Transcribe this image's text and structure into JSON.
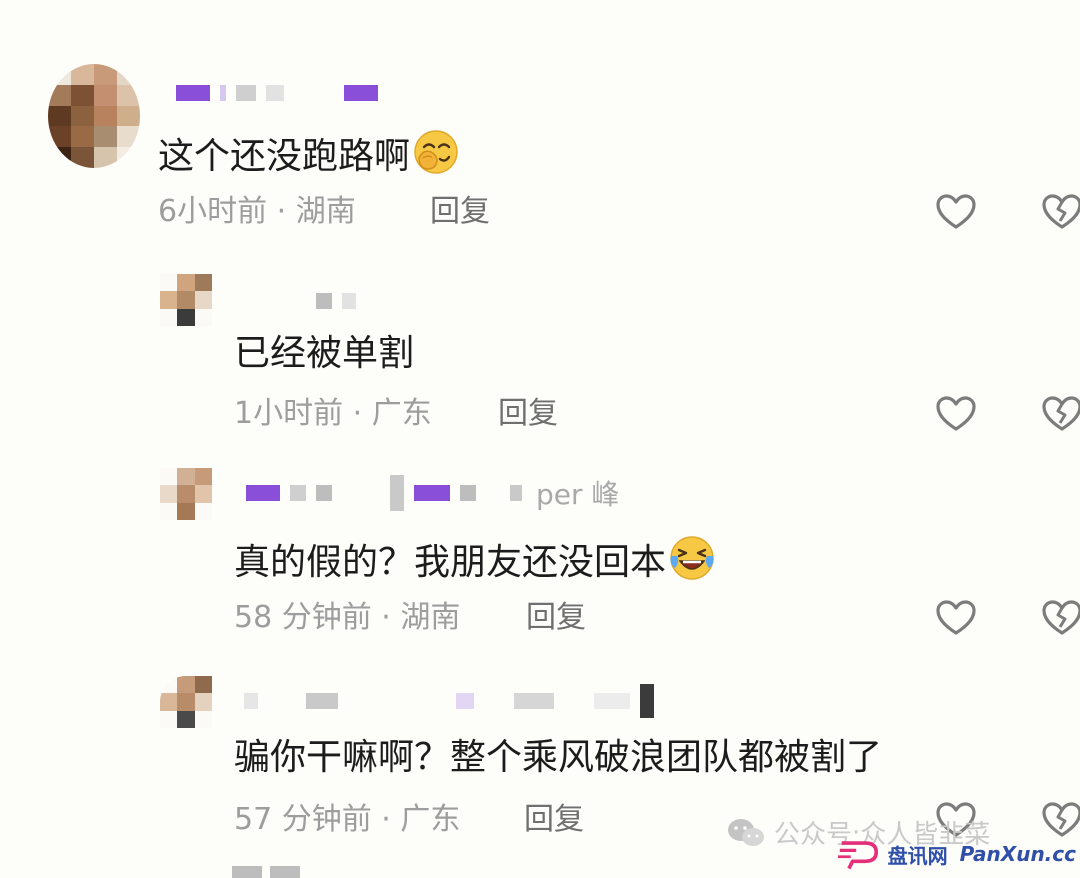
{
  "comments": [
    {
      "text": "这个还没跑路啊",
      "emoji": "smirk-hand-over-mouth-emoji",
      "time": "6小时前",
      "sep": " · ",
      "location": "湖南",
      "reply_label": "回复"
    },
    {
      "text": "已经被单割",
      "time": "1小时前",
      "sep": " · ",
      "location": "广东",
      "reply_label": "回复"
    },
    {
      "text": "真的假的？我朋友还没回本",
      "emoji": "laughing-crying-emoji",
      "username_suffix": "per 峰",
      "time": "58 分钟前",
      "sep": " · ",
      "location": "湖南",
      "reply_label": "回复"
    },
    {
      "text": "骗你干嘛啊？整个乘风破浪团队都被割了",
      "time": "57 分钟前",
      "sep": " · ",
      "location": "广东",
      "reply_label": "回复"
    }
  ],
  "watermark": {
    "prefix": "公众号",
    "separator": " · ",
    "name": "众人皆韭菜"
  },
  "brand": {
    "name": "盘讯网",
    "url": "PanXun.cc"
  },
  "colors": {
    "username_block": "#8a4fd8",
    "meta_text": "#9d9d9d",
    "icon_stroke": "#7c7c7c"
  }
}
